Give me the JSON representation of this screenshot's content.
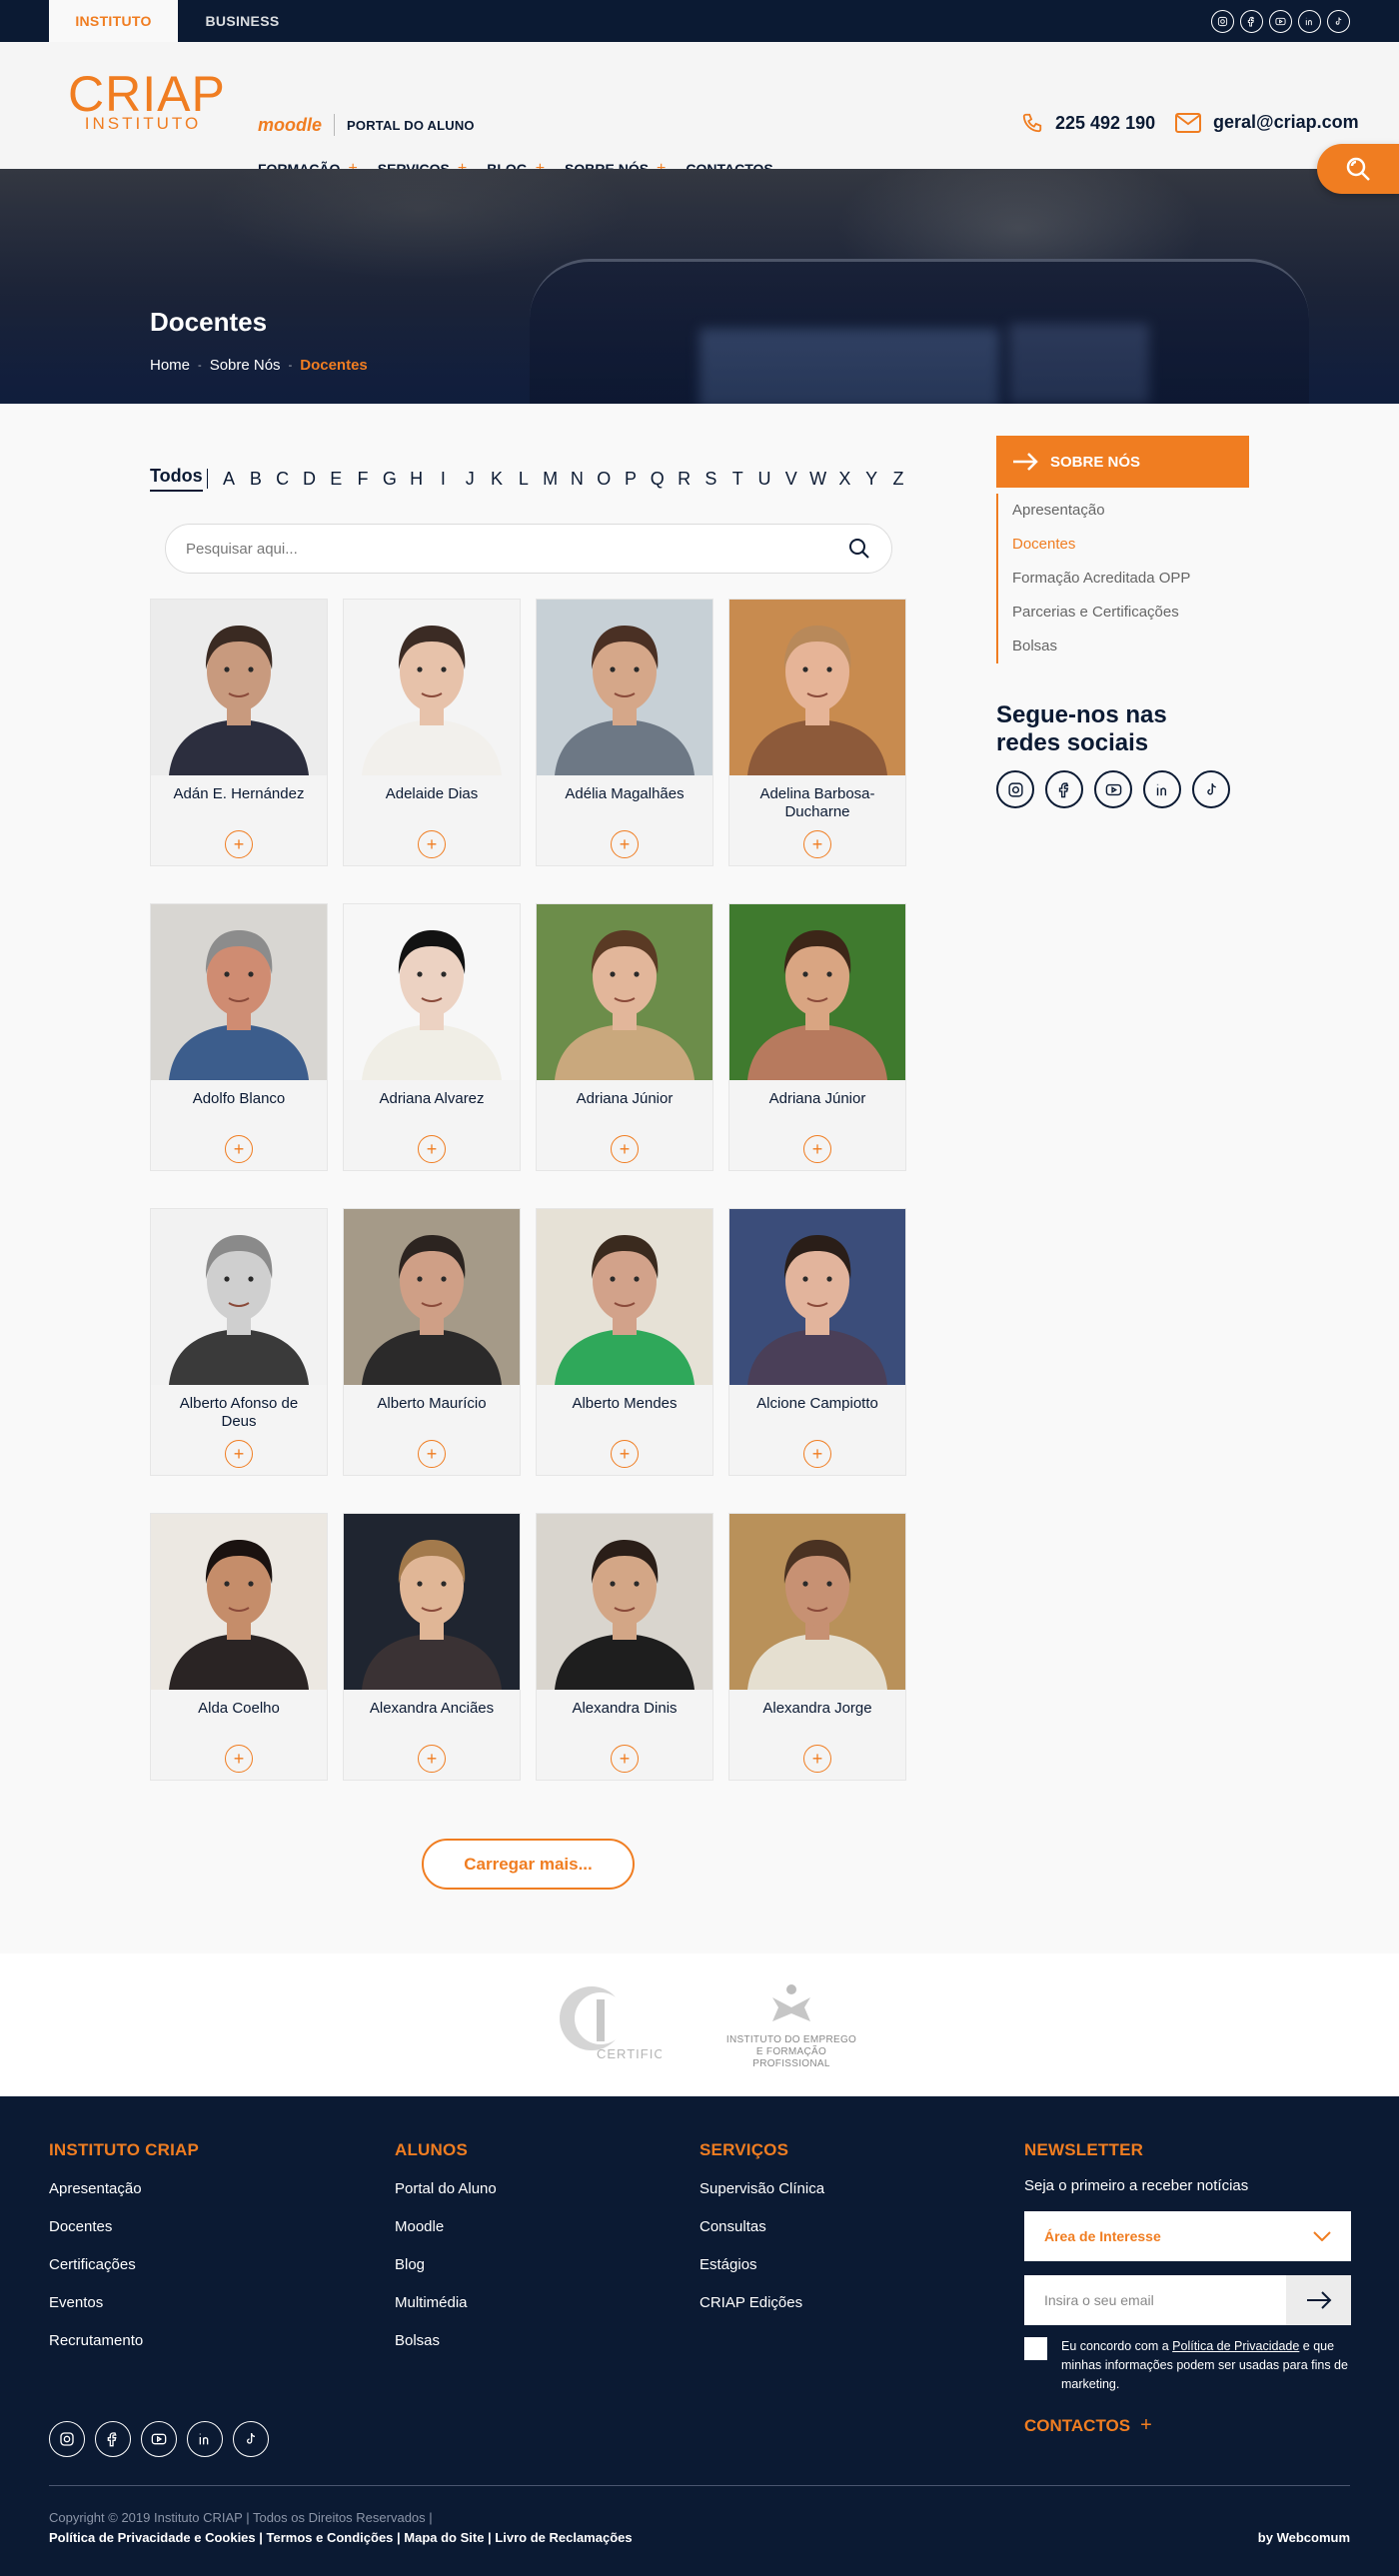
{
  "topbar": {
    "tabs": [
      {
        "label": "INSTITUTO",
        "active": true
      },
      {
        "label": "BUSINESS",
        "active": false
      }
    ],
    "social_icons": [
      "instagram-icon",
      "facebook-icon",
      "youtube-icon",
      "linkedin-icon",
      "tiktok-icon"
    ]
  },
  "header": {
    "logo_main": "CRIAP",
    "logo_sub": "INSTITUTO",
    "moodle": "moodle",
    "portal": "PORTAL DO ALUNO",
    "nav": [
      {
        "label": "FORMAÇÃO",
        "has_sub": true
      },
      {
        "label": "SERVIÇOS",
        "has_sub": true
      },
      {
        "label": "BLOG",
        "has_sub": true
      },
      {
        "label": "SOBRE NÓS",
        "has_sub": true
      },
      {
        "label": "CONTACTOS",
        "has_sub": false
      }
    ],
    "phone": "225 492 190",
    "email": "geral@criap.com",
    "accent_color": "#f07d21",
    "dark_color": "#0b1a33"
  },
  "hero": {
    "title": "Docentes",
    "breadcrumb": [
      "Home",
      "Sobre Nós",
      "Docentes"
    ]
  },
  "filter": {
    "all_label": "Todos",
    "letters": [
      "A",
      "B",
      "C",
      "D",
      "E",
      "F",
      "G",
      "H",
      "I",
      "J",
      "K",
      "L",
      "M",
      "N",
      "O",
      "P",
      "Q",
      "R",
      "S",
      "T",
      "U",
      "V",
      "W",
      "X",
      "Y",
      "Z"
    ]
  },
  "search": {
    "placeholder": "Pesquisar aqui..."
  },
  "teachers": [
    {
      "name": "Adán E. Hernández"
    },
    {
      "name": "Adelaide Dias"
    },
    {
      "name": "Adélia Magalhães"
    },
    {
      "name": "Adelina Barbosa-Ducharne"
    },
    {
      "name": "Adolfo Blanco"
    },
    {
      "name": "Adriana Alvarez"
    },
    {
      "name": "Adriana Júnior"
    },
    {
      "name": "Adriana Júnior"
    },
    {
      "name": "Alberto Afonso de Deus"
    },
    {
      "name": "Alberto Maurício"
    },
    {
      "name": "Alberto Mendes"
    },
    {
      "name": "Alcione Campiotto"
    },
    {
      "name": "Alda Coelho"
    },
    {
      "name": "Alexandra Anciães"
    },
    {
      "name": "Alexandra Dinis"
    },
    {
      "name": "Alexandra Jorge"
    }
  ],
  "load_more": "Carregar mais...",
  "sidebar": {
    "heading": "SOBRE NÓS",
    "items": [
      {
        "label": "Apresentação",
        "active": false
      },
      {
        "label": "Docentes",
        "active": true
      },
      {
        "label": "Formação Acreditada OPP",
        "active": false
      },
      {
        "label": "Parcerias e Certificações",
        "active": false
      },
      {
        "label": "Bolsas",
        "active": false
      }
    ],
    "follow": "Segue-nos nas redes sociais"
  },
  "partners": {
    "p1_line": "CERTIFICADA",
    "p2_line1": "INSTITUTO DO EMPREGO",
    "p2_line2": "E FORMAÇÃO PROFISSIONAL"
  },
  "footer": {
    "col1": {
      "title": "INSTITUTO CRIAP",
      "links": [
        "Apresentação",
        "Docentes",
        "Certificações",
        "Eventos",
        "Recrutamento"
      ]
    },
    "col2": {
      "title": "ALUNOS",
      "links": [
        "Portal do Aluno",
        "Moodle",
        "Blog",
        "Multimédia",
        "Bolsas"
      ]
    },
    "col3": {
      "title": "SERVIÇOS",
      "links": [
        "Supervisão Clínica",
        "Consultas",
        "Estágios",
        "CRIAP Edições"
      ]
    },
    "newsletter": {
      "title": "NEWSLETTER",
      "subtitle": "Seja o primeiro a receber notícias",
      "interest": "Área de Interesse",
      "email_placeholder": "Insira o seu email",
      "consent_pre": "Eu concordo com a ",
      "consent_link": "Política de Privacidade",
      "consent_post": " e que minhas informações podem ser usadas para fins de marketing."
    },
    "contacts": "CONTACTOS",
    "copyright": "Copyright © 2019 Instituto CRIAP | Todos os Direitos Reservados |",
    "legal": "Política de Privacidade e Cookies | Termos e Condições | Mapa do Site | Livro de Reclamações",
    "by": "by Webcomum"
  }
}
